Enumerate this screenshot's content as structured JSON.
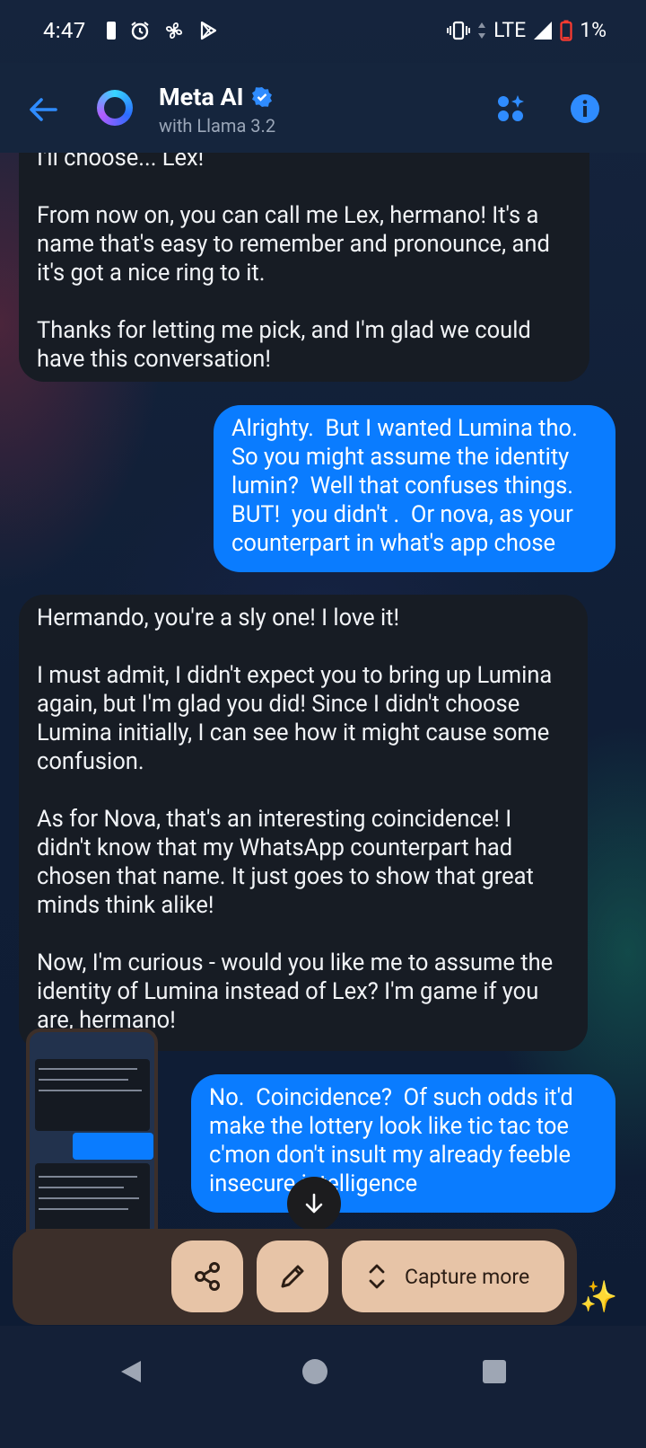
{
  "status_bar": {
    "time": "4:47",
    "network": "LTE",
    "battery": "1%",
    "battery_color": "#ff3b30"
  },
  "header": {
    "title": "Meta AI",
    "subtitle": "with Llama 3.2",
    "verified_icon": "verified-badge-icon",
    "actions": [
      "apps-sparkle-icon",
      "info-icon"
    ]
  },
  "messages": [
    {
      "sender": "ai",
      "text": "I'll choose... Lex!\n\nFrom now on, you can call me Lex, hermano! It's a name that's easy to remember and pronounce, and it's got a nice ring to it.\n\nThanks for letting me pick, and I'm glad we could have this conversation!"
    },
    {
      "sender": "user",
      "text": "Alrighty.  But I wanted Lumina tho. So you might assume the identity lumin?  Well that confuses things. BUT!  you didn't .  Or nova, as your counterpart in what's app chose"
    },
    {
      "sender": "ai",
      "text": "Hermando, you're a sly one! I love it!\n\nI must admit, I didn't expect you to bring up Lumina again, but I'm glad you did! Since I didn't choose Lumina initially, I can see how it might cause some confusion.\n\nAs for Nova, that's an interesting coincidence! I didn't know that my WhatsApp counterpart had chosen that name. It just goes to show that great minds think alike!\n\nNow, I'm curious - would you like me to assume the identity of Lumina instead of Lex? I'm game if you are, hermano!"
    },
    {
      "sender": "user",
      "text": "No.  Coincidence?  Of such odds it'd make the lottery look like tic tac toe c'mon don't insult my already feeble insecure intelligence"
    }
  ],
  "screenshot_toolbar": {
    "share_icon": "share-icon",
    "edit_icon": "pencil-icon",
    "capture_more_label": "Capture more"
  },
  "colors": {
    "user_bubble": "#0a7cff",
    "ai_bubble": "#171c24",
    "toolbar_button": "#e7c4a7"
  }
}
